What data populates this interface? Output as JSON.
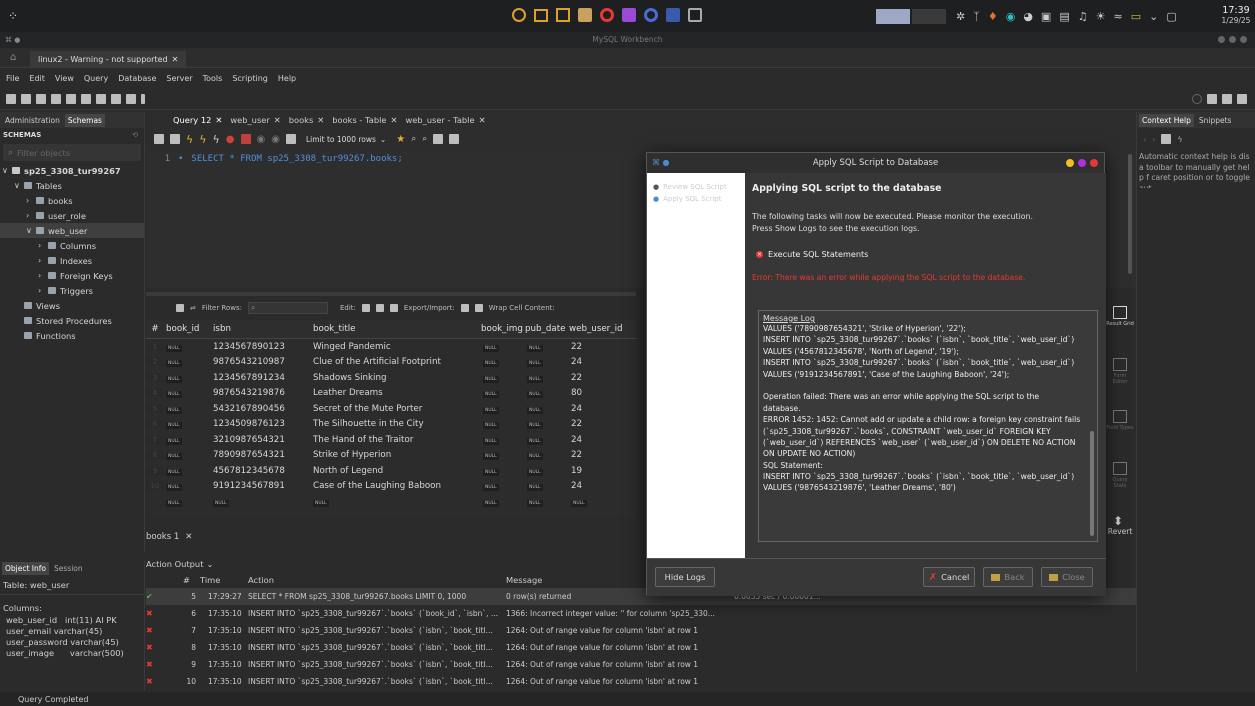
{
  "system": {
    "clock_time": "17:39",
    "clock_date": "1/29/25"
  },
  "window": {
    "title": "MySQL Workbench",
    "connection_tab": "linux2 - Warning - not supported"
  },
  "menu": [
    "File",
    "Edit",
    "View",
    "Query",
    "Database",
    "Server",
    "Tools",
    "Scripting",
    "Help"
  ],
  "left_panel": {
    "tabs": [
      "Administration",
      "Schemas"
    ],
    "header": "SCHEMAS",
    "filter_placeholder": "Filter objects",
    "tree": [
      {
        "label": "sp25_3308_tur99267",
        "level": 0,
        "icon": "database-icon",
        "expanded": true
      },
      {
        "label": "Tables",
        "level": 1,
        "icon": "folder-icon",
        "expanded": true
      },
      {
        "label": "books",
        "level": 2,
        "icon": "table-icon",
        "expanded": false
      },
      {
        "label": "user_role",
        "level": 2,
        "icon": "table-icon",
        "expanded": false
      },
      {
        "label": "web_user",
        "level": 2,
        "icon": "table-icon",
        "expanded": true,
        "selected": true
      },
      {
        "label": "Columns",
        "level": 3,
        "icon": "columns-icon",
        "expanded": false
      },
      {
        "label": "Indexes",
        "level": 3,
        "icon": "folder-icon",
        "expanded": false
      },
      {
        "label": "Foreign Keys",
        "level": 3,
        "icon": "folder-icon",
        "expanded": false
      },
      {
        "label": "Triggers",
        "level": 3,
        "icon": "folder-icon",
        "expanded": false
      },
      {
        "label": "Views",
        "level": 1,
        "icon": "folder-icon",
        "expanded": null
      },
      {
        "label": "Stored Procedures",
        "level": 1,
        "icon": "folder-icon",
        "expanded": null
      },
      {
        "label": "Functions",
        "level": 1,
        "icon": "folder-icon",
        "expanded": null
      }
    ]
  },
  "object_info": {
    "tabs": [
      "Object Info",
      "Session"
    ],
    "table_line": "Table: web_user",
    "columns_label": "Columns:",
    "columns": [
      "web_user_id   int(11) AI PK",
      "user_email varchar(45)",
      "user_password varchar(45)",
      "user_image      varchar(500)"
    ]
  },
  "query_tabs": [
    "Query 12",
    "web_user",
    "books",
    "books - Table",
    "web_user - Table"
  ],
  "editor": {
    "limit_label": "Limit to 1000 rows",
    "line_number": "1",
    "sql_text": "SELECT * FROM sp25_3308_tur99267.books;"
  },
  "results_toolbar": {
    "filter_label": "Filter Rows:",
    "edit_label": "Edit:",
    "export_label": "Export/Import:",
    "wrap_label": "Wrap Cell Content:"
  },
  "grid": {
    "headers": [
      "#",
      "book_id",
      "isbn",
      "book_title",
      "book_img",
      "pub_date",
      "web_user_id"
    ],
    "rows": [
      {
        "n": "1",
        "book_id": "NULL",
        "isbn": "1234567890123",
        "title": "Winged Pandemic",
        "img": "NULL",
        "date": "NULL",
        "uid": "22"
      },
      {
        "n": "2",
        "book_id": "NULL",
        "isbn": "9876543210987",
        "title": "Clue of the Artificial Footprint",
        "img": "NULL",
        "date": "NULL",
        "uid": "24"
      },
      {
        "n": "3",
        "book_id": "NULL",
        "isbn": "1234567891234",
        "title": "Shadows Sinking",
        "img": "NULL",
        "date": "NULL",
        "uid": "22"
      },
      {
        "n": "4",
        "book_id": "NULL",
        "isbn": "9876543219876",
        "title": "Leather Dreams",
        "img": "NULL",
        "date": "NULL",
        "uid": "80"
      },
      {
        "n": "5",
        "book_id": "NULL",
        "isbn": "5432167890456",
        "title": "Secret of the Mute Porter",
        "img": "NULL",
        "date": "NULL",
        "uid": "24"
      },
      {
        "n": "6",
        "book_id": "NULL",
        "isbn": "1234509876123",
        "title": "The Silhouette in the City",
        "img": "NULL",
        "date": "NULL",
        "uid": "22"
      },
      {
        "n": "7",
        "book_id": "NULL",
        "isbn": "3210987654321",
        "title": "The Hand of the Traitor",
        "img": "NULL",
        "date": "NULL",
        "uid": "24"
      },
      {
        "n": "8",
        "book_id": "NULL",
        "isbn": "7890987654321",
        "title": "Strike of Hyperion",
        "img": "NULL",
        "date": "NULL",
        "uid": "22"
      },
      {
        "n": "9",
        "book_id": "NULL",
        "isbn": "4567812345678",
        "title": "North of Legend",
        "img": "NULL",
        "date": "NULL",
        "uid": "19"
      },
      {
        "n": "10",
        "book_id": "NULL",
        "isbn": "9191234567891",
        "title": "Case of the Laughing Baboon",
        "img": "NULL",
        "date": "NULL",
        "uid": "24"
      },
      {
        "n": "",
        "book_id": "NULL",
        "isbn": "NULL",
        "title": "NULL",
        "img": "NULL",
        "date": "NULL",
        "uid": "NULL"
      }
    ]
  },
  "result_tab": "books 1",
  "action_output": {
    "selector": "Action Output",
    "headers": [
      "#",
      "Time",
      "Action",
      "Message",
      ""
    ],
    "rows": [
      {
        "status": "ok",
        "n": "5",
        "time": "17:29:27",
        "action": "SELECT * FROM sp25_3308_tur99267.books LIMIT 0, 1000",
        "message": "0 row(s) returned",
        "duration": "0.0055 sec / 0.00001..."
      },
      {
        "status": "err",
        "n": "6",
        "time": "17:35:10",
        "action": "INSERT INTO `sp25_3308_tur99267`.`books` (`book_id`, `isbn`, ...",
        "message": "1366: Incorrect integer value: '' for column 'sp25_330...",
        "duration": ""
      },
      {
        "status": "err",
        "n": "7",
        "time": "17:35:10",
        "action": "INSERT INTO `sp25_3308_tur99267`.`books` (`isbn`, `book_titl...",
        "message": "1264: Out of range value for column 'isbn' at row 1",
        "duration": ""
      },
      {
        "status": "err",
        "n": "8",
        "time": "17:35:10",
        "action": "INSERT INTO `sp25_3308_tur99267`.`books` (`isbn`, `book_titl...",
        "message": "1264: Out of range value for column 'isbn' at row 1",
        "duration": ""
      },
      {
        "status": "err",
        "n": "9",
        "time": "17:35:10",
        "action": "INSERT INTO `sp25_3308_tur99267`.`books` (`isbn`, `book_titl...",
        "message": "1264: Out of range value for column 'isbn' at row 1",
        "duration": ""
      },
      {
        "status": "err",
        "n": "10",
        "time": "17:35:10",
        "action": "INSERT INTO `sp25_3308_tur99267`.`books` (`isbn`, `book_titl...",
        "message": "1264: Out of range value for column 'isbn' at row 1",
        "duration": ""
      }
    ]
  },
  "status_bar": "Query Completed",
  "right_panel": {
    "tabs": [
      "Context Help",
      "Snippets"
    ],
    "help_text": "Automatic context help is disa toolbar to manually get help f caret position or to toggle aut"
  },
  "side_strip": [
    "Result Grid",
    "Form Editor",
    "Field Types",
    "Query Stats",
    "Revert"
  ],
  "dialog": {
    "title": "Apply SQL Script to Database",
    "steps": [
      "Review SQL Script",
      "Apply SQL Script"
    ],
    "heading": "Applying SQL script to the database",
    "description": "The following tasks will now be executed. Please monitor the execution. Press Show Logs to see the execution logs.",
    "task": "Execute SQL Statements",
    "error": "Error: There was an error while applying the SQL script to the database.",
    "log_label": "Message Log",
    "log_lines": [
      "VALUES ('7890987654321', 'Strike of Hyperion', '22');",
      "INSERT INTO `sp25_3308_tur99267`.`books` (`isbn`, `book_title`, `web_user_id`)",
      "VALUES ('4567812345678', 'North of Legend', '19');",
      "INSERT INTO `sp25_3308_tur99267`.`books` (`isbn`, `book_title`, `web_user_id`)",
      "VALUES ('9191234567891', 'Case of the Laughing Baboon', '24');",
      "",
      "Operation failed: There was an error while applying the SQL script to the",
      "database.",
      "ERROR 1452: 1452: Cannot add or update a child row: a foreign key constraint fails",
      "(`sp25_3308_tur99267`.`books`, CONSTRAINT `web_user_id` FOREIGN KEY",
      "(`web_user_id`) REFERENCES `web_user` (`web_user_id`) ON DELETE NO ACTION",
      "ON UPDATE NO ACTION)",
      "SQL Statement:",
      "INSERT INTO `sp25_3308_tur99267`.`books` (`isbn`, `book_title`, `web_user_id`)",
      "VALUES ('9876543219876', 'Leather Dreams', '80')"
    ],
    "hide_logs": "Hide Logs",
    "cancel": "Cancel",
    "back": "Back",
    "close": "Close"
  },
  "colors": {
    "error_red": "#e53935",
    "keyword_blue": "#4f8fe0",
    "dialog_bg": "#373737"
  }
}
